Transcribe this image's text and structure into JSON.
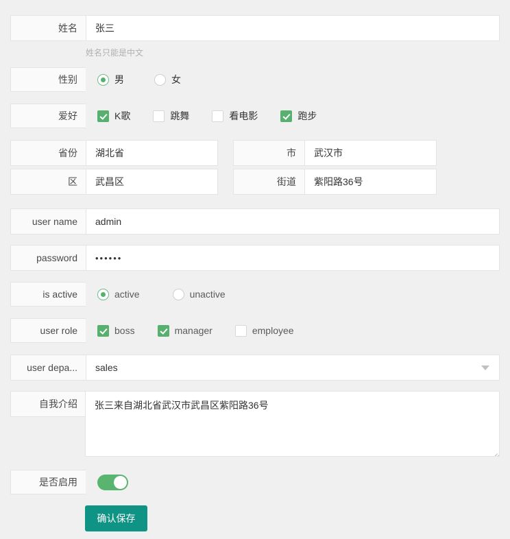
{
  "theme": {
    "page_bg": "#f0f0f0",
    "label_bg": "#fafafa",
    "field_bg": "#ffffff",
    "border": "#e4e4e4",
    "accent_green": "#57b06e",
    "submit_teal": "#0e9384",
    "hint_gray": "#b0b0b0"
  },
  "form": {
    "name_row": {
      "label": "姓名",
      "value": "张三",
      "hint": "姓名只能是中文"
    },
    "gender_row": {
      "label": "性别",
      "options": [
        {
          "label": "男",
          "checked": true
        },
        {
          "label": "女",
          "checked": false
        }
      ]
    },
    "hobby_row": {
      "label": "爱好",
      "options": [
        {
          "label": "K歌",
          "checked": true
        },
        {
          "label": "跳舞",
          "checked": false
        },
        {
          "label": "看电影",
          "checked": false
        },
        {
          "label": "跑步",
          "checked": true
        }
      ]
    },
    "province_row": {
      "label": "省份",
      "value": "湖北省"
    },
    "city_row": {
      "label": "市",
      "value": "武汉市"
    },
    "district_row": {
      "label": "区",
      "value": "武昌区"
    },
    "street_row": {
      "label": "街道",
      "value": "紫阳路36号"
    },
    "username_row": {
      "label": "user name",
      "value": "admin"
    },
    "password_row": {
      "label": "password",
      "value": "••••••"
    },
    "is_active_row": {
      "label": "is active",
      "options": [
        {
          "label": "active",
          "checked": true
        },
        {
          "label": "unactive",
          "checked": false
        }
      ]
    },
    "user_role_row": {
      "label": "user role",
      "options": [
        {
          "label": "boss",
          "checked": true
        },
        {
          "label": "manager",
          "checked": true
        },
        {
          "label": "employee",
          "checked": false
        }
      ]
    },
    "department_row": {
      "label": "user depa...",
      "value": "sales",
      "icon": "chevron-down-icon"
    },
    "intro_row": {
      "label": "自我介绍",
      "value": "张三来自湖北省武汉市武昌区紫阳路36号"
    },
    "enabled_row": {
      "label": "是否启用",
      "state": "on"
    },
    "submit": {
      "label": "确认保存"
    }
  }
}
